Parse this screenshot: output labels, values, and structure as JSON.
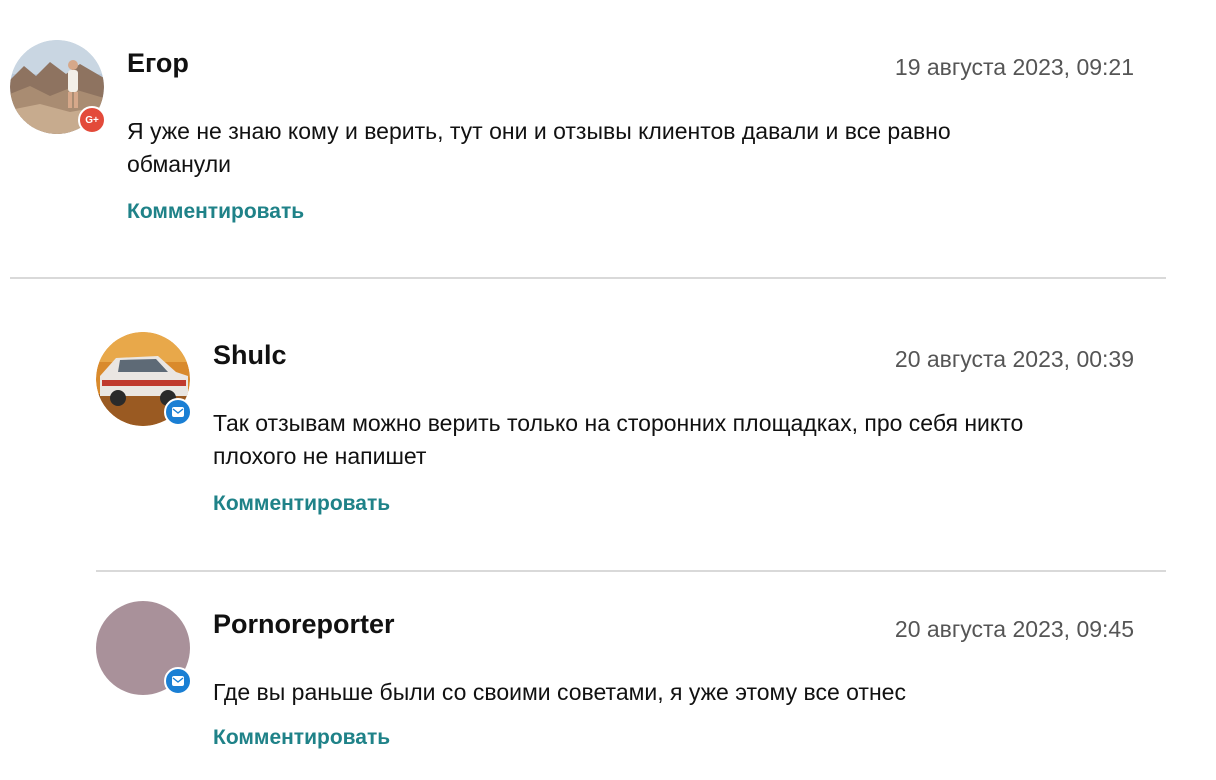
{
  "comments": [
    {
      "author": "Егор",
      "date": "19 августа 2023, 09:21",
      "text": "Я уже не знаю кому и верить, тут они и отзывы клиентов давали и все равно обманули",
      "reply_label": "Комментировать",
      "avatar": "photo-desert",
      "badge": {
        "icon": "google-plus-icon",
        "label": "G+",
        "color": "#e34a3a"
      }
    },
    {
      "author": "Shulc",
      "date": "20 августа 2023, 00:39",
      "text": "Так отзывам можно верить только на сторонних площадках, про себя никто плохого не напишет",
      "reply_label": "Комментировать",
      "avatar": "photo-car",
      "badge": {
        "icon": "mail-icon",
        "color": "#1a7fd4"
      }
    },
    {
      "author": "Pornoreporter",
      "date": "20 августа 2023, 09:45",
      "text": "Где вы раньше были со своими советами, я уже этому все отнес",
      "reply_label": "Комментировать",
      "avatar": "plain-mauve",
      "badge": {
        "icon": "mail-icon",
        "color": "#1a7fd4"
      }
    }
  ],
  "colors": {
    "link": "#1f8288",
    "date": "#555555",
    "divider": "#d9d9d9",
    "avatar_plain": "#a9919a"
  }
}
